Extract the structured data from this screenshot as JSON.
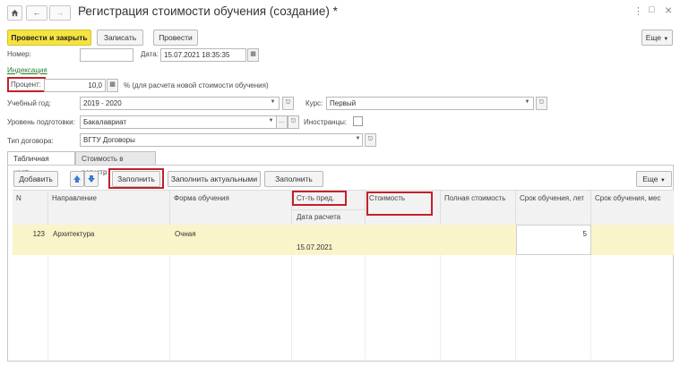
{
  "window": {
    "title": "Регистрация стоимости обучения (создание) *",
    "more_label": "⋮",
    "max_label": "□",
    "close_label": "×"
  },
  "toolbar": {
    "post_close": "Провести и закрыть",
    "save": "Записать",
    "post": "Провести",
    "more": "Еще"
  },
  "header": {
    "number_label": "Номер:",
    "number_value": "",
    "date_label": "Дата:",
    "date_value": "15.07.2021 18:35:35",
    "indexation_link": "Индексация",
    "percent_label": "Процент:",
    "percent_value": "10,0",
    "percent_note": "% (для расчета новой стоимости обучения)",
    "year_label": "Учебный год:",
    "year_value": "2019 - 2020",
    "course_label": "Курс:",
    "course_value": "Первый",
    "level_label": "Уровень подготовки:",
    "level_value": "Бакалавриат",
    "foreigners_label": "Иностранцы:",
    "contract_label": "Тип договора:",
    "contract_value": "ВГТУ Договоры"
  },
  "tabs": [
    "Табличная часть",
    "Стоимость в регистр"
  ],
  "table_toolbar": {
    "add": "Добавить",
    "fill": "Заполнить",
    "fill_actual": "Заполнить актуальными",
    "fill_plans": "Заполнить планы",
    "more": "Еще"
  },
  "table": {
    "columns": {
      "n": "N",
      "direction": "Направление",
      "form": "Форма обучения",
      "cost_prev": "Ст-ть пред.",
      "calc_date": "Дата расчета",
      "cost": "Стоимость",
      "full_cost": "Полная стоимость",
      "years": "Срок обучения, лет",
      "months": "Срок обучения, мес"
    },
    "rows": [
      {
        "n": "123",
        "direction": "Архитектура",
        "form": "Очная",
        "calc_date": "15.07.2021",
        "years": "5"
      }
    ]
  },
  "colors": {
    "primary_button": "#f5e342",
    "highlight_row": "#fbf3c9",
    "annotation_red": "#c3202b",
    "link_green": "#2a7a2e"
  },
  "icons": [
    "home-icon",
    "back-arrow-icon",
    "forward-arrow-icon",
    "star-icon",
    "calendar-icon",
    "dropdown-arrow-icon",
    "open-icon",
    "move-up-icon",
    "move-down-icon",
    "calculator-icon"
  ]
}
